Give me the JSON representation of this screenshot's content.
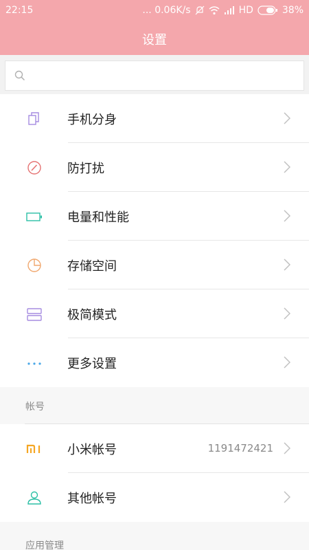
{
  "status_bar": {
    "time": "22:15",
    "network_speed": "... 0.06K/s",
    "network_type": "HD",
    "battery": "38%"
  },
  "header": {
    "title": "设置"
  },
  "search": {
    "placeholder": "",
    "value": ""
  },
  "settings": [
    {
      "label": "手机分身",
      "icon": "dual-apps-icon"
    },
    {
      "label": "防打扰",
      "icon": "do-not-disturb-icon"
    },
    {
      "label": "电量和性能",
      "icon": "battery-icon"
    },
    {
      "label": "存储空间",
      "icon": "storage-pie-icon"
    },
    {
      "label": "极简模式",
      "icon": "simple-mode-icon"
    },
    {
      "label": "更多设置",
      "icon": "more-dots-icon"
    }
  ],
  "accounts_section": {
    "title": "帐号",
    "items": [
      {
        "label": "小米帐号",
        "value": "1191472421",
        "icon": "mi-logo-icon"
      },
      {
        "label": "其他帐号",
        "value": "",
        "icon": "person-icon"
      }
    ]
  },
  "apps_section": {
    "title": "应用管理"
  },
  "colors": {
    "header": "#f4a7ac",
    "purple_icon": "#a58be0",
    "red_icon": "#e57373",
    "teal_icon": "#2bbfa5",
    "orange_icon": "#f0a76e",
    "blue_icon": "#4aa7e8",
    "mi_orange": "#f5a623"
  }
}
